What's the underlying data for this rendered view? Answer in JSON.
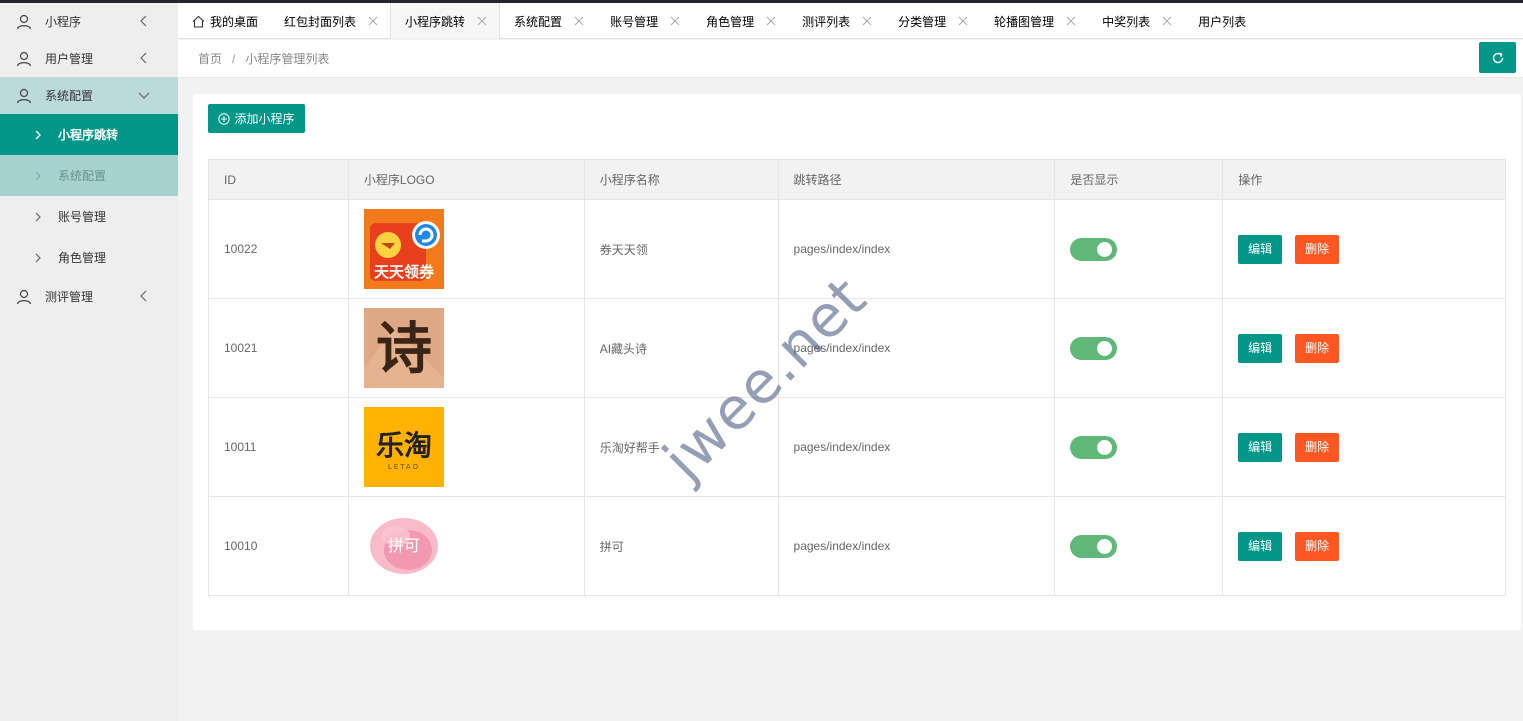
{
  "sidebar": {
    "items": [
      {
        "label": "小程序"
      },
      {
        "label": "用户管理"
      },
      {
        "label": "系统配置",
        "children": [
          {
            "label": "小程序跳转"
          },
          {
            "label": "系统配置"
          },
          {
            "label": "账号管理"
          },
          {
            "label": "角色管理"
          }
        ]
      },
      {
        "label": "测评管理"
      }
    ]
  },
  "tabs": [
    {
      "label": "我的桌面"
    },
    {
      "label": "红包封面列表"
    },
    {
      "label": "小程序跳转"
    },
    {
      "label": "系统配置"
    },
    {
      "label": "账号管理"
    },
    {
      "label": "角色管理"
    },
    {
      "label": "测评列表"
    },
    {
      "label": "分类管理"
    },
    {
      "label": "轮播图管理"
    },
    {
      "label": "中奖列表"
    },
    {
      "label": "用户列表"
    }
  ],
  "breadcrumb": {
    "home": "首页",
    "separator": "/",
    "current": "小程序管理列表"
  },
  "toolbar": {
    "add_label": "添加小程序"
  },
  "table": {
    "headers": [
      "ID",
      "小程序LOGO",
      "小程序名称",
      "跳转路径",
      "是否显示",
      "操作"
    ],
    "rows": [
      {
        "id": "10022",
        "logo_text": "天天领券",
        "logo_icon": "coupon-logo",
        "name": "券天天领",
        "path": "pages/index/index",
        "visible": true
      },
      {
        "id": "10021",
        "logo_text": "诗",
        "logo_icon": "poem-logo",
        "name": "AI藏头诗",
        "path": "pages/index/index",
        "visible": true
      },
      {
        "id": "10011",
        "logo_text": "乐淘",
        "logo_sub": "LETAO",
        "logo_icon": "letao-logo",
        "name": "乐淘好帮手",
        "path": "pages/index/index",
        "visible": true
      },
      {
        "id": "10010",
        "logo_text": "拼可",
        "logo_icon": "pinke-logo",
        "name": "拼可",
        "path": "pages/index/index",
        "visible": true
      }
    ],
    "edit_label": "编辑",
    "delete_label": "删除"
  },
  "watermark": "jwee.net",
  "colors": {
    "primary": "#009688",
    "danger": "#ff5722",
    "switch_on": "#5fb878"
  }
}
